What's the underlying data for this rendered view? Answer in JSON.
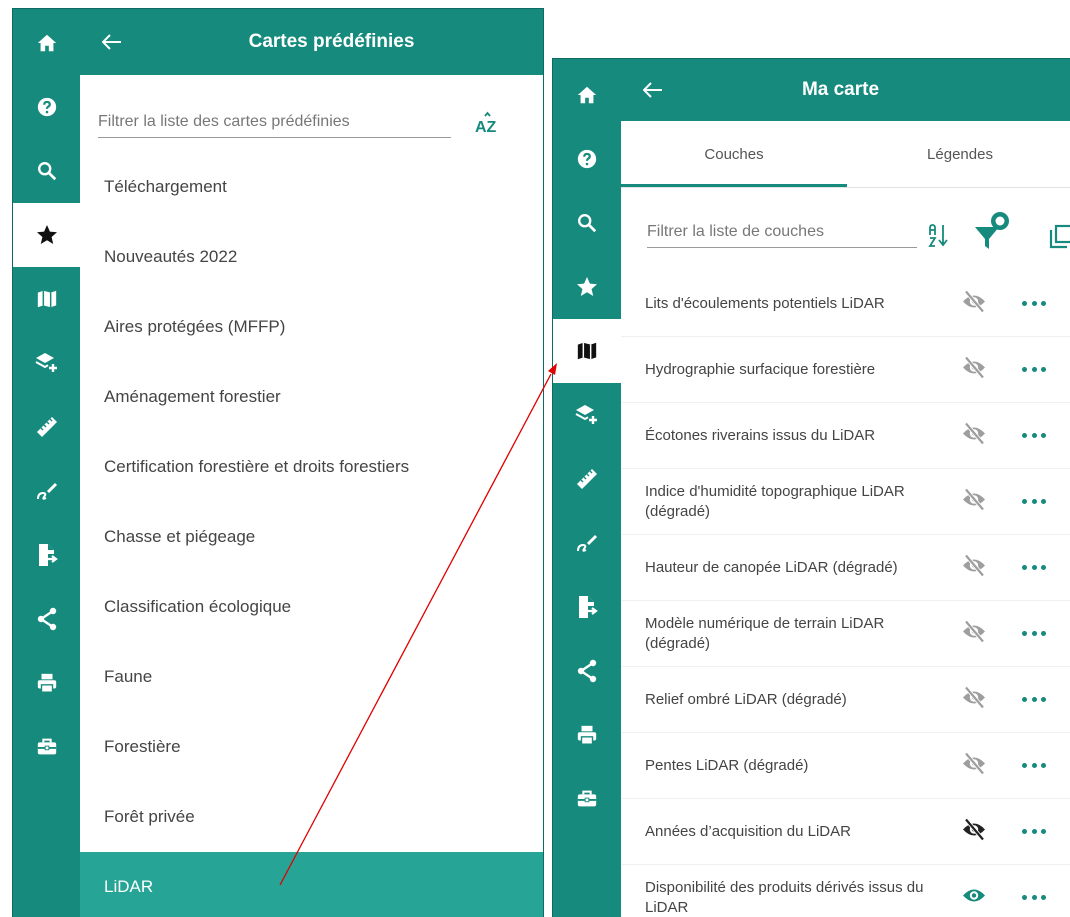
{
  "panel1": {
    "title": "Cartes prédéfinies",
    "filter_placeholder": "Filtrer la liste des cartes prédéfinies",
    "sort_label": "AZ",
    "items": [
      {
        "label": "Téléchargement"
      },
      {
        "label": "Nouveautés 2022"
      },
      {
        "label": "Aires protégées (MFFP)"
      },
      {
        "label": "Aménagement forestier"
      },
      {
        "label": "Certification forestière et droits forestiers"
      },
      {
        "label": "Chasse et piégeage"
      },
      {
        "label": "Classification écologique"
      },
      {
        "label": "Faune"
      },
      {
        "label": "Forestière"
      },
      {
        "label": "Forêt privée"
      },
      {
        "label": "LiDAR",
        "selected": true
      }
    ]
  },
  "panel2": {
    "title": "Ma carte",
    "tabs": [
      {
        "label": "Couches",
        "active": true
      },
      {
        "label": "Légendes",
        "active": false
      }
    ],
    "filter_placeholder": "Filtrer la liste de couches",
    "layers": [
      {
        "name": "Lits d'écoulements potentiels LiDAR",
        "visible": false
      },
      {
        "name": "Hydrographie surfacique forestière",
        "visible": false
      },
      {
        "name": "Écotones riverains issus du LiDAR",
        "visible": false
      },
      {
        "name": "Indice d'humidité topographique LiDAR (dégradé)",
        "visible": false
      },
      {
        "name": "Hauteur de canopée LiDAR (dégradé)",
        "visible": false
      },
      {
        "name": "Modèle numérique de terrain LiDAR (dégradé)",
        "visible": false
      },
      {
        "name": "Relief ombré LiDAR (dégradé)",
        "visible": false
      },
      {
        "name": "Pentes LiDAR (dégradé)",
        "visible": false
      },
      {
        "name": "Années d’acquisition du LiDAR",
        "visible": false,
        "emphasis": true
      },
      {
        "name": "Disponibilité des produits dérivés issus du LiDAR",
        "visible": true
      }
    ]
  },
  "rail_icons": [
    "home-icon",
    "help-icon",
    "search-icon",
    "star-icon",
    "map-icon",
    "add-layer-icon",
    "ruler-icon",
    "draw-icon",
    "export-file-icon",
    "share-icon",
    "print-icon",
    "toolbox-icon"
  ],
  "colors": {
    "brand": "#168a7d",
    "selected_row": "#26a596",
    "annotation_arrow": "#e00000",
    "hidden_eye": "#9e9e9e"
  }
}
